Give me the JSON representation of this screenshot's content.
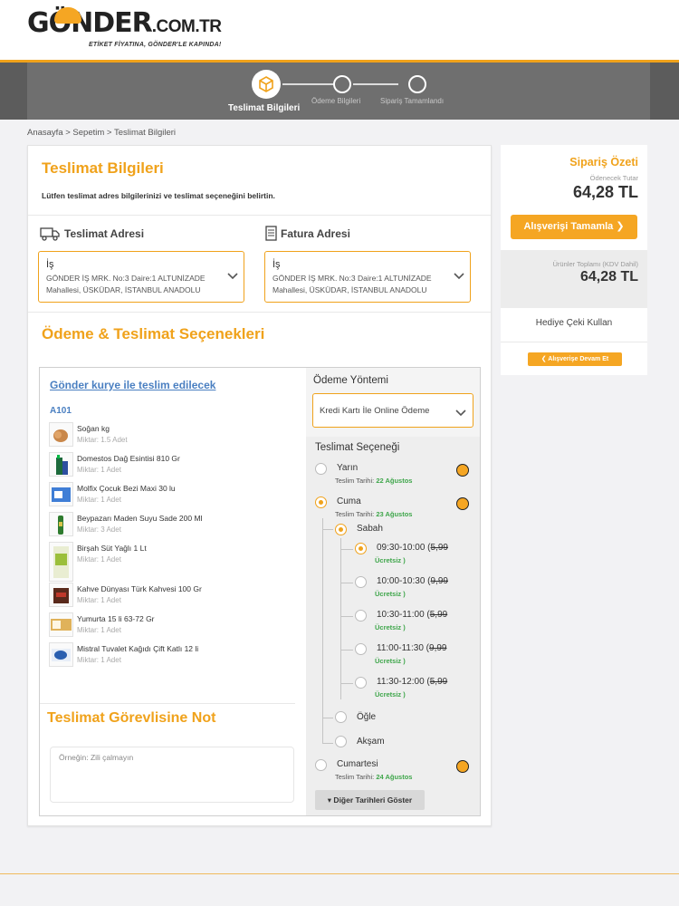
{
  "brand": {
    "name": "GÖNDER",
    "tld": ".COM.TR",
    "tagline": "ETİKET FİYATINA, GÖNDER'LE KAPINDA!",
    "accent": "#f0a21b"
  },
  "steps": [
    {
      "label": "Teslimat Bilgileri",
      "active": true
    },
    {
      "label": "Ödeme Bilgileri",
      "active": false
    },
    {
      "label": "Sipariş Tamamlandı",
      "active": false
    }
  ],
  "breadcrumb": "Anasayfa > Sepetim > Teslimat Bilgileri",
  "delivery_info": {
    "title": "Teslimat Bilgileri",
    "description": "Lütfen teslimat adres bilgilerinizi ve teslimat seçeneğini belirtin."
  },
  "addresses": {
    "shipping": {
      "heading": "Teslimat Adresi",
      "type": "İş",
      "line1": "GÖNDER İŞ MRK. No:3 Daire:1 ALTUNİZADE",
      "line2": "Mahallesi, ÜSKÜDAR, İSTANBUL ANADOLU"
    },
    "billing": {
      "heading": "Fatura Adresi",
      "type": "İş",
      "line1": "GÖNDER İŞ MRK. No:3 Daire:1 ALTUNİZADE",
      "line2": "Mahallesi, ÜSKÜDAR, İSTANBUL ANADOLU"
    }
  },
  "options_title": "Ödeme & Teslimat Seçenekleri",
  "courier_link": "Gönder kurye ile teslim edilecek",
  "store": "A101",
  "products": [
    {
      "name": "Soğan kg",
      "qty": "Miktar: 1.5 Adet"
    },
    {
      "name": "Domestos Dağ Esintisi 810 Gr",
      "qty": "Miktar: 1 Adet"
    },
    {
      "name": "Molfix Çocuk Bezi Maxi 30 lu",
      "qty": "Miktar: 1 Adet"
    },
    {
      "name": "Beypazarı Maden Suyu Sade 200 Ml",
      "qty": "Miktar: 3 Adet"
    },
    {
      "name": "Birşah Süt Yağlı 1 Lt",
      "qty": "Miktar: 1 Adet"
    },
    {
      "name": "Kahve Dünyası Türk Kahvesi 100 Gr",
      "qty": "Miktar: 1 Adet"
    },
    {
      "name": "Yumurta 15 li 63-72 Gr",
      "qty": "Miktar: 1 Adet"
    },
    {
      "name": "Mistral Tuvalet Kağıdı Çift Katlı 12 li",
      "qty": "Miktar: 1 Adet"
    }
  ],
  "note": {
    "title": "Teslimat Görevlisine Not",
    "placeholder": "Örneğin: Zili çalmayın"
  },
  "payment": {
    "heading": "Ödeme Yöntemi",
    "selected": "Kredi Kartı İle Online Ödeme"
  },
  "delivery": {
    "heading": "Teslimat Seçeneği",
    "date_prefix": "Teslim Tarihi:",
    "days": [
      {
        "label": "Yarın",
        "date": "22 Ağustos",
        "selected": false
      },
      {
        "label": "Cuma",
        "date": "23 Ağustos",
        "selected": true
      },
      {
        "label": "Cumartesi",
        "date": "24 Ağustos",
        "selected": false
      }
    ],
    "periods": [
      {
        "label": "Sabah",
        "selected": true
      },
      {
        "label": "Öğle",
        "selected": false
      },
      {
        "label": "Akşam",
        "selected": false
      }
    ],
    "slots": [
      {
        "time": "09:30-10:00",
        "price": "5,99",
        "selected": true
      },
      {
        "time": "10:00-10:30",
        "price": "9,99",
        "selected": false
      },
      {
        "time": "10:30-11:00",
        "price": "5,99",
        "selected": false
      },
      {
        "time": "11:00-11:30",
        "price": "9,99",
        "selected": false
      },
      {
        "time": "11:30-12:00",
        "price": "5,99",
        "selected": false
      }
    ],
    "free_label": "Ücretsiz",
    "more_label": "▾ Diğer Tarihleri Göster"
  },
  "summary": {
    "title": "Sipariş Özeti",
    "due_label": "Ödenecek Tutar",
    "due_amount": "64,28 TL",
    "complete_label": "Alışverişi Tamamla ❯",
    "products_total_label": "Ürünler Toplamı (KDV Dahil)",
    "products_total": "64,28 TL",
    "gift_label": "Hediye Çeki Kullan",
    "continue_label": "❮ Alışverişe Devam Et"
  }
}
